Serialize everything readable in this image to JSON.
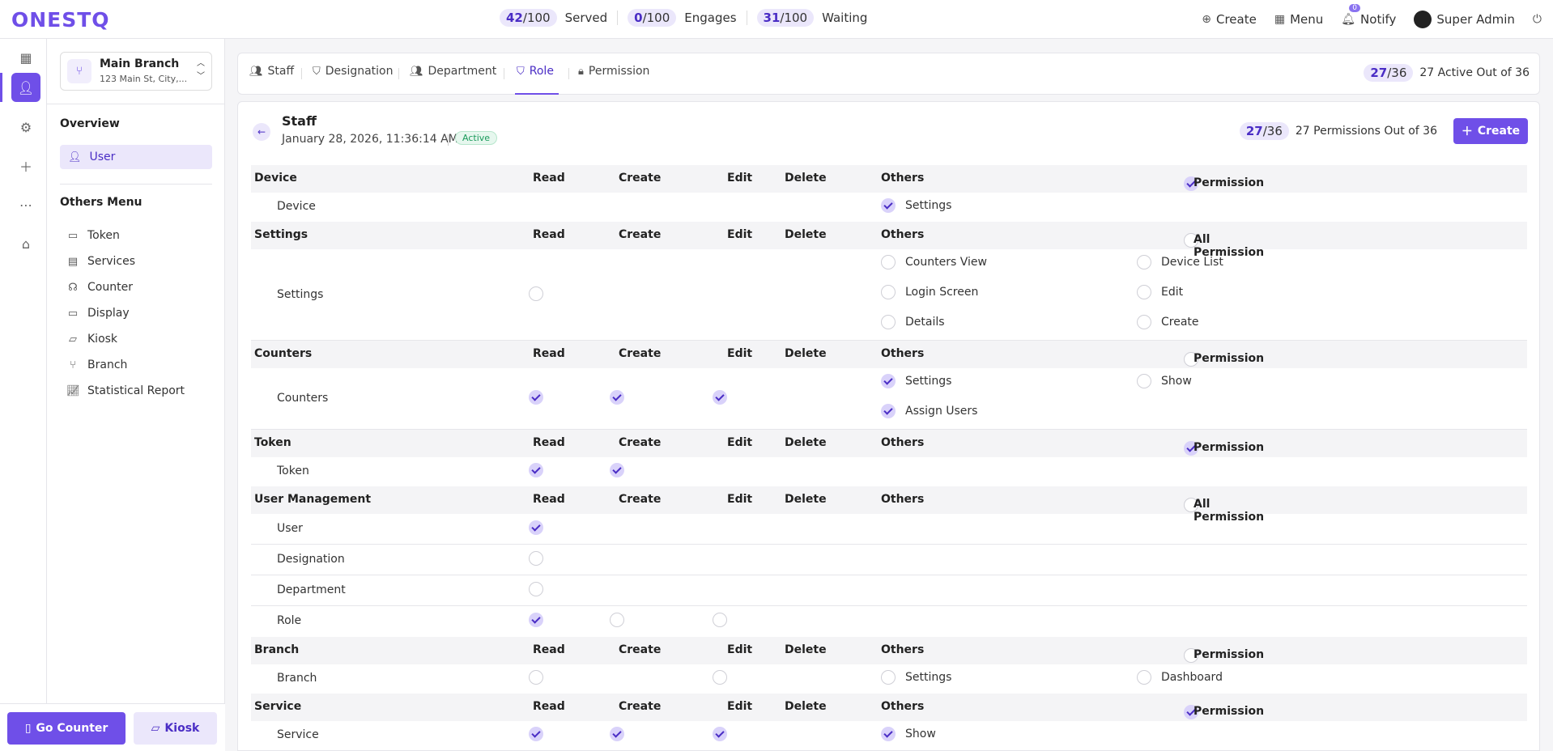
{
  "app": {
    "logo": "ONESTQ"
  },
  "stats": [
    {
      "value": "42",
      "total": "100",
      "label": "Served"
    },
    {
      "value": "0",
      "total": "100",
      "label": "Engages"
    },
    {
      "value": "31",
      "total": "100",
      "label": "Waiting"
    }
  ],
  "top_actions": {
    "create": "Create",
    "menu": "Menu",
    "notify": "Notify",
    "notify_count": "0",
    "user": "Super Admin"
  },
  "branch": {
    "name": "Main Branch",
    "address": "123 Main St, City,..."
  },
  "sidebar": {
    "overview_heading": "Overview",
    "user_item": "User",
    "others_heading": "Others Menu",
    "items": [
      "Token",
      "Services",
      "Counter",
      "Display",
      "Kiosk",
      "Branch",
      "Statistical Report"
    ]
  },
  "bottom": {
    "go_counter": "Go Counter",
    "kiosk": "Kiosk"
  },
  "tabs": {
    "items": [
      "Staff",
      "Designation",
      "Department",
      "Role",
      "Permission"
    ],
    "active": "Role",
    "count_value": "27",
    "count_total": "36",
    "count_text": "27 Active Out of 36"
  },
  "panel": {
    "title": "Staff",
    "date": "January 28, 2026, 11:36:14 AM",
    "badge": "Active",
    "count_value": "27",
    "count_total": "36",
    "count_text": "27 Permissions Out of 36",
    "create": "Create"
  },
  "columns": {
    "read": "Read",
    "create": "Create",
    "edit": "Edit",
    "delete": "Delete",
    "others": "Others"
  },
  "sections": [
    {
      "name": "Device",
      "perm_label": "Permission",
      "perm_checked": true,
      "rows": [
        {
          "label": "Device",
          "read": null,
          "create": null,
          "edit": null,
          "delete": null,
          "others": [
            {
              "label": "Settings",
              "checked": true
            }
          ]
        }
      ]
    },
    {
      "name": "Settings",
      "perm_label": "All Permission",
      "perm_checked": false,
      "rows": [
        {
          "label": "Settings",
          "read": false,
          "create": null,
          "edit": null,
          "delete": null,
          "others": [
            {
              "label": "Counters View",
              "checked": false
            },
            {
              "label": "Device List",
              "checked": false
            },
            {
              "label": "Login Screen",
              "checked": false
            },
            {
              "label": "Edit",
              "checked": false
            },
            {
              "label": "Details",
              "checked": false
            },
            {
              "label": "Create",
              "checked": false
            }
          ]
        }
      ]
    },
    {
      "name": "Counters",
      "perm_label": "Permission",
      "perm_checked": false,
      "rows": [
        {
          "label": "Counters",
          "read": true,
          "create": true,
          "edit": true,
          "delete": null,
          "others": [
            {
              "label": "Settings",
              "checked": true
            },
            {
              "label": "Show",
              "checked": false
            },
            {
              "label": "Assign Users",
              "checked": true
            }
          ]
        }
      ]
    },
    {
      "name": "Token",
      "perm_label": "Permission",
      "perm_checked": true,
      "rows": [
        {
          "label": "Token",
          "read": true,
          "create": true,
          "edit": null,
          "delete": null,
          "others": []
        }
      ]
    },
    {
      "name": "User Management",
      "perm_label": "All Permission",
      "perm_checked": false,
      "rows": [
        {
          "label": "User",
          "read": true,
          "create": null,
          "edit": null,
          "delete": null,
          "others": []
        },
        {
          "label": "Designation",
          "read": false,
          "create": null,
          "edit": null,
          "delete": null,
          "others": []
        },
        {
          "label": "Department",
          "read": false,
          "create": null,
          "edit": null,
          "delete": null,
          "others": []
        },
        {
          "label": "Role",
          "read": true,
          "create": false,
          "edit": false,
          "delete": null,
          "others": []
        }
      ]
    },
    {
      "name": "Branch",
      "perm_label": "Permission",
      "perm_checked": false,
      "rows": [
        {
          "label": "Branch",
          "read": false,
          "create": null,
          "edit": false,
          "delete": null,
          "others": [
            {
              "label": "Settings",
              "checked": false
            },
            {
              "label": "Dashboard",
              "checked": false
            }
          ]
        }
      ]
    },
    {
      "name": "Service",
      "perm_label": "Permission",
      "perm_checked": true,
      "rows": [
        {
          "label": "Service",
          "read": true,
          "create": true,
          "edit": true,
          "delete": null,
          "others": [
            {
              "label": "Show",
              "checked": true
            }
          ]
        }
      ]
    }
  ],
  "colors": {
    "accent": "#6f4fe8",
    "accent_soft": "#ebe7fb",
    "active_badge": "#1a9a5a"
  },
  "icons": {
    "rail": [
      "dashboard-icon",
      "user-icon",
      "gear-icon",
      "plus-icon",
      "more-icon",
      "broom-icon"
    ]
  }
}
